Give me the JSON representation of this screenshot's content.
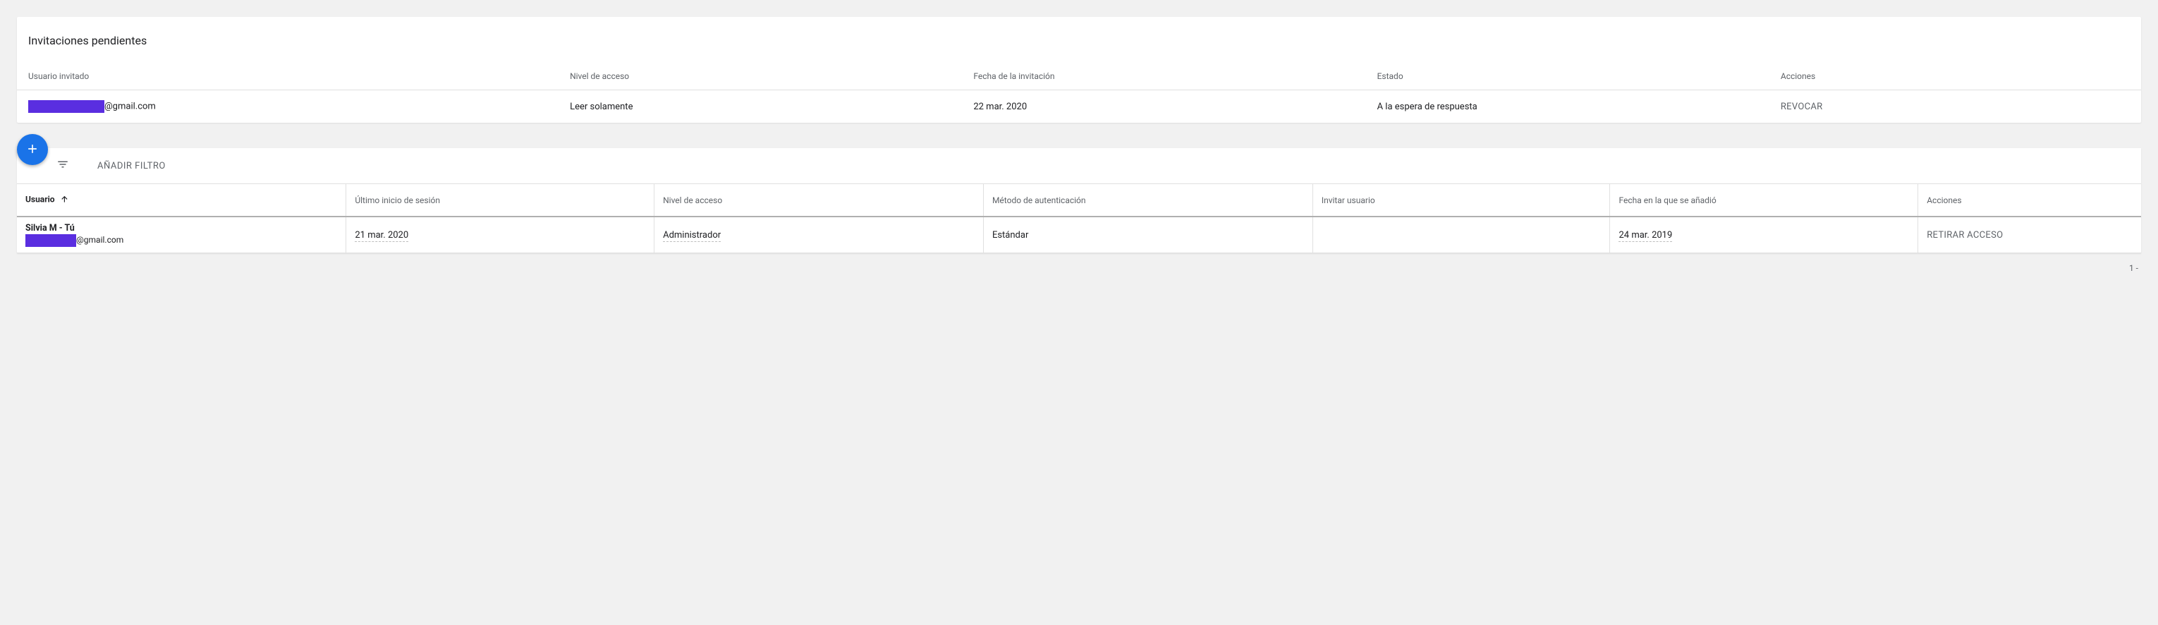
{
  "pending": {
    "title": "Invitaciones pendientes",
    "headers": {
      "user": "Usuario invitado",
      "level": "Nivel de acceso",
      "date": "Fecha de la invitación",
      "status": "Estado",
      "actions": "Acciones"
    },
    "rows": [
      {
        "email_domain": "@gmail.com",
        "level": "Leer solamente",
        "date": "22 mar. 2020",
        "status": "A la espera de respuesta",
        "action": "REVOCAR"
      }
    ]
  },
  "users": {
    "add_filter_label": "AÑADIR FILTRO",
    "headers": {
      "user": "Usuario",
      "last_login": "Último inicio de sesión",
      "level": "Nivel de acceso",
      "auth": "Método de autenticación",
      "invite": "Invitar usuario",
      "added": "Fecha en la que se añadió",
      "actions": "Acciones"
    },
    "rows": [
      {
        "name": "Silvia M - Tú",
        "email_domain": "@gmail.com",
        "last_login": "21 mar. 2020",
        "level": "Administrador",
        "auth": "Estándar",
        "invite": "",
        "added": "24 mar. 2019",
        "action": "RETIRAR ACCESO"
      }
    ],
    "pagination": "1 -"
  }
}
